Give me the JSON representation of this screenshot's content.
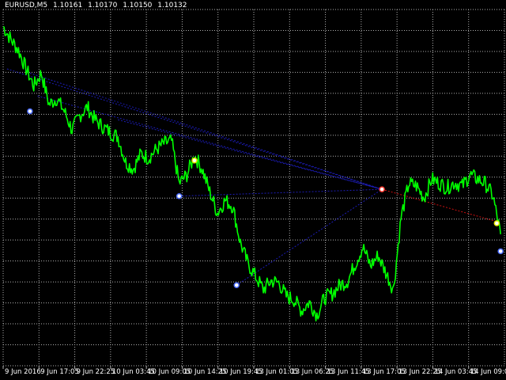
{
  "header": {
    "symbol": "EURUSD,M5",
    "open": "1.10161",
    "high": "1.10170",
    "low": "1.10150",
    "close": "1.10132"
  },
  "colors": {
    "background": "#000000",
    "grid": "#b0b0b0",
    "price_line": "#00ff00",
    "trend_lines": "#1c1cb4",
    "projection_line": "#cc1111",
    "marker_blue": "#4a6cff",
    "marker_red": "#ff3b2f",
    "marker_yellow": "#e8e800"
  },
  "chart_data": {
    "type": "line",
    "instrument": "EURUSD",
    "timeframe": "M5",
    "x_tick_labels": [
      "9 Jun 2016",
      "9 Jun 17:05",
      "9 Jun 22:25",
      "10 Jun 03:45",
      "10 Jun 09:05",
      "10 Jun 14:25",
      "10 Jun 19:45",
      "13 Jun 01:05",
      "13 Jun 06:25",
      "13 Jun 11:45",
      "13 Jun 17:05",
      "13 Jun 22:25",
      "14 Jun 03:45",
      "14 Jun 09:05"
    ],
    "grid": true,
    "series": [
      {
        "type": "price",
        "x_index": [
          0,
          2,
          4,
          6,
          8,
          10,
          12,
          14,
          16,
          18,
          20,
          22,
          24,
          26,
          28,
          30,
          32,
          34,
          36,
          38,
          40,
          42,
          44,
          46,
          48,
          50,
          52,
          54,
          56,
          58,
          60,
          62,
          64,
          66,
          68,
          70,
          72,
          74,
          76,
          78,
          80,
          82,
          84,
          86,
          88,
          90,
          92,
          94,
          96,
          98,
          100,
          102,
          104,
          106,
          108,
          110,
          112,
          114,
          116,
          118,
          120,
          122,
          124,
          126,
          128,
          130
        ],
        "values": [
          1.14,
          1.1385,
          1.1372,
          1.135,
          1.133,
          1.1345,
          1.1308,
          1.1315,
          1.13,
          1.1278,
          1.1295,
          1.1305,
          1.129,
          1.1282,
          1.1275,
          1.127,
          1.124,
          1.1232,
          1.125,
          1.1245,
          1.1255,
          1.1262,
          1.1265,
          1.1215,
          1.1225,
          1.1248,
          1.1232,
          1.1205,
          1.118,
          1.1195,
          1.1188,
          1.1145,
          1.112,
          1.1105,
          1.109,
          1.11,
          1.1098,
          1.1082,
          1.1078,
          1.1065,
          1.1075,
          1.106,
          1.108,
          1.1085,
          1.1095,
          1.11,
          1.112,
          1.114,
          1.1118,
          1.113,
          1.111,
          1.109,
          1.1175,
          1.1215,
          1.1212,
          1.1198,
          1.122,
          1.1215,
          1.121,
          1.1216,
          1.1212,
          1.1225,
          1.122,
          1.1215,
          1.12,
          1.1155
        ]
      }
    ],
    "trend_lines": [
      {
        "from": [
          1,
          1.135
        ],
        "to": [
          99,
          1.1208
        ]
      },
      {
        "from": [
          7,
          1.1345
        ],
        "to": [
          99,
          1.1208
        ]
      },
      {
        "from": [
          9,
          1.1318
        ],
        "to": [
          99,
          1.1208
        ]
      },
      {
        "from": [
          30,
          1.129
        ],
        "to": [
          99,
          1.1208
        ]
      },
      {
        "from": [
          46,
          1.12
        ],
        "to": [
          99,
          1.1208
        ]
      },
      {
        "from": [
          61,
          1.1095
        ],
        "to": [
          99,
          1.1208
        ]
      },
      {
        "from": [
          99,
          1.1208
        ],
        "to": [
          129,
          1.117
        ]
      }
    ],
    "markers": [
      {
        "x": 7,
        "y": 1.13,
        "color": "blue"
      },
      {
        "x": 50,
        "y": 1.1242,
        "color": "yellow"
      },
      {
        "x": 46,
        "y": 1.12,
        "color": "blue"
      },
      {
        "x": 61,
        "y": 1.1095,
        "color": "blue"
      },
      {
        "x": 99,
        "y": 1.1208,
        "color": "red"
      },
      {
        "x": 129,
        "y": 1.1168,
        "color": "yellow"
      },
      {
        "x": 130,
        "y": 1.1135,
        "color": "blue"
      }
    ],
    "ylim": [
      1.1,
      1.142
    ],
    "xlim": [
      0,
      131
    ]
  }
}
